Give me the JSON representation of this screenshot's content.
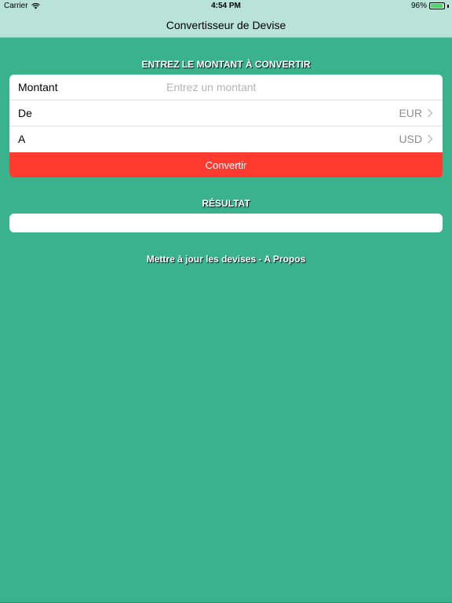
{
  "status_bar": {
    "carrier": "Carrier",
    "time": "4:54 PM",
    "battery": "96%",
    "battery_level": 0.96
  },
  "nav": {
    "title": "Convertisseur de Devise"
  },
  "input_section": {
    "header": "ENTREZ LE MONTANT À CONVERTIR",
    "amount_label": "Montant",
    "amount_placeholder": "Entrez un montant",
    "amount_value": "",
    "from_label": "De",
    "from_value": "EUR",
    "to_label": "A",
    "to_value": "USD",
    "convert_label": "Convertir"
  },
  "result_section": {
    "header": "RÉSULTAT",
    "value": ""
  },
  "footer": {
    "update_link": "Mettre à jour les devises",
    "separator": " - ",
    "about_link": "A Propos"
  },
  "colors": {
    "background": "#3ab28c",
    "bar": "#b9e3d6",
    "button": "#ff3b30"
  },
  "icons": [
    "wifi-icon",
    "battery-icon",
    "chevron-right-icon"
  ]
}
